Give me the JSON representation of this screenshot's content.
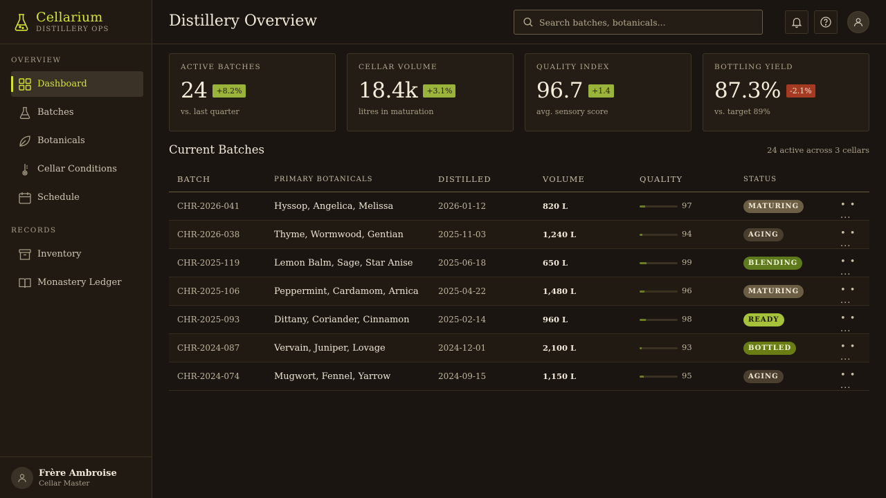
{
  "brand": {
    "title": "Cellarium",
    "subtitle": "DISTILLERY OPS"
  },
  "nav": {
    "overview_label": "OVERVIEW",
    "records_label": "RECORDS",
    "items": [
      {
        "label": "Dashboard",
        "icon": "grid-icon"
      },
      {
        "label": "Batches",
        "icon": "flask-icon"
      },
      {
        "label": "Botanicals",
        "icon": "leaf-icon"
      },
      {
        "label": "Cellar Conditions",
        "icon": "thermometer-icon"
      },
      {
        "label": "Schedule",
        "icon": "calendar-icon"
      },
      {
        "label": "Inventory",
        "icon": "archive-icon"
      },
      {
        "label": "Monastery Ledger",
        "icon": "book-icon"
      }
    ]
  },
  "user": {
    "name": "Frère Ambroise",
    "role": "Cellar Master"
  },
  "header": {
    "title": "Distillery Overview",
    "search_placeholder": "Search batches, botanicals..."
  },
  "stats": [
    {
      "label": "ACTIVE BATCHES",
      "value": "24",
      "delta": "+8.2%",
      "sub": "vs. last quarter"
    },
    {
      "label": "CELLAR VOLUME",
      "value": "18.4k",
      "delta": "+3.1%",
      "sub": "litres in maturation"
    },
    {
      "label": "QUALITY INDEX",
      "value": "96.7",
      "delta": "+1.4",
      "sub": "avg. sensory score"
    },
    {
      "label": "BOTTLING YIELD",
      "value": "87.3%",
      "delta": "-2.1%",
      "sub": "vs. target 89%"
    }
  ],
  "batches": {
    "title": "Current Batches",
    "meta": "24 active across 3 cellars",
    "columns": [
      "BATCH",
      "PRIMARY BOTANICALS",
      "DISTILLED",
      "VOLUME",
      "QUALITY",
      "STATUS"
    ],
    "more": "• • ...",
    "rows": [
      {
        "id": "CHR-2026-041",
        "botanicals": "Hyssop, Angelica, Melissa",
        "date": "2026-01-12",
        "volume": "820 L",
        "quality": "97",
        "status": "MATURING"
      },
      {
        "id": "CHR-2026-038",
        "botanicals": "Thyme, Wormwood, Gentian",
        "date": "2025-11-03",
        "volume": "1,240 L",
        "quality": "94",
        "status": "AGING"
      },
      {
        "id": "CHR-2025-119",
        "botanicals": "Lemon Balm, Sage, Star Anise",
        "date": "2025-06-18",
        "volume": "650 L",
        "quality": "99",
        "status": "BLENDING"
      },
      {
        "id": "CHR-2025-106",
        "botanicals": "Peppermint, Cardamom, Arnica",
        "date": "2025-04-22",
        "volume": "1,480 L",
        "quality": "96",
        "status": "MATURING"
      },
      {
        "id": "CHR-2025-093",
        "botanicals": "Dittany, Coriander, Cinnamon",
        "date": "2025-02-14",
        "volume": "960 L",
        "quality": "98",
        "status": "READY"
      },
      {
        "id": "CHR-2024-087",
        "botanicals": "Vervain, Juniper, Lovage",
        "date": "2024-12-01",
        "volume": "2,100 L",
        "quality": "93",
        "status": "BOTTLED"
      },
      {
        "id": "CHR-2024-074",
        "botanicals": "Mugwort, Fennel, Yarrow",
        "date": "2024-09-15",
        "volume": "1,150 L",
        "quality": "95",
        "status": "AGING"
      }
    ]
  },
  "colors": {
    "accent": "#d6e332",
    "positive": "#9ab33a",
    "negative": "#a33a21"
  }
}
